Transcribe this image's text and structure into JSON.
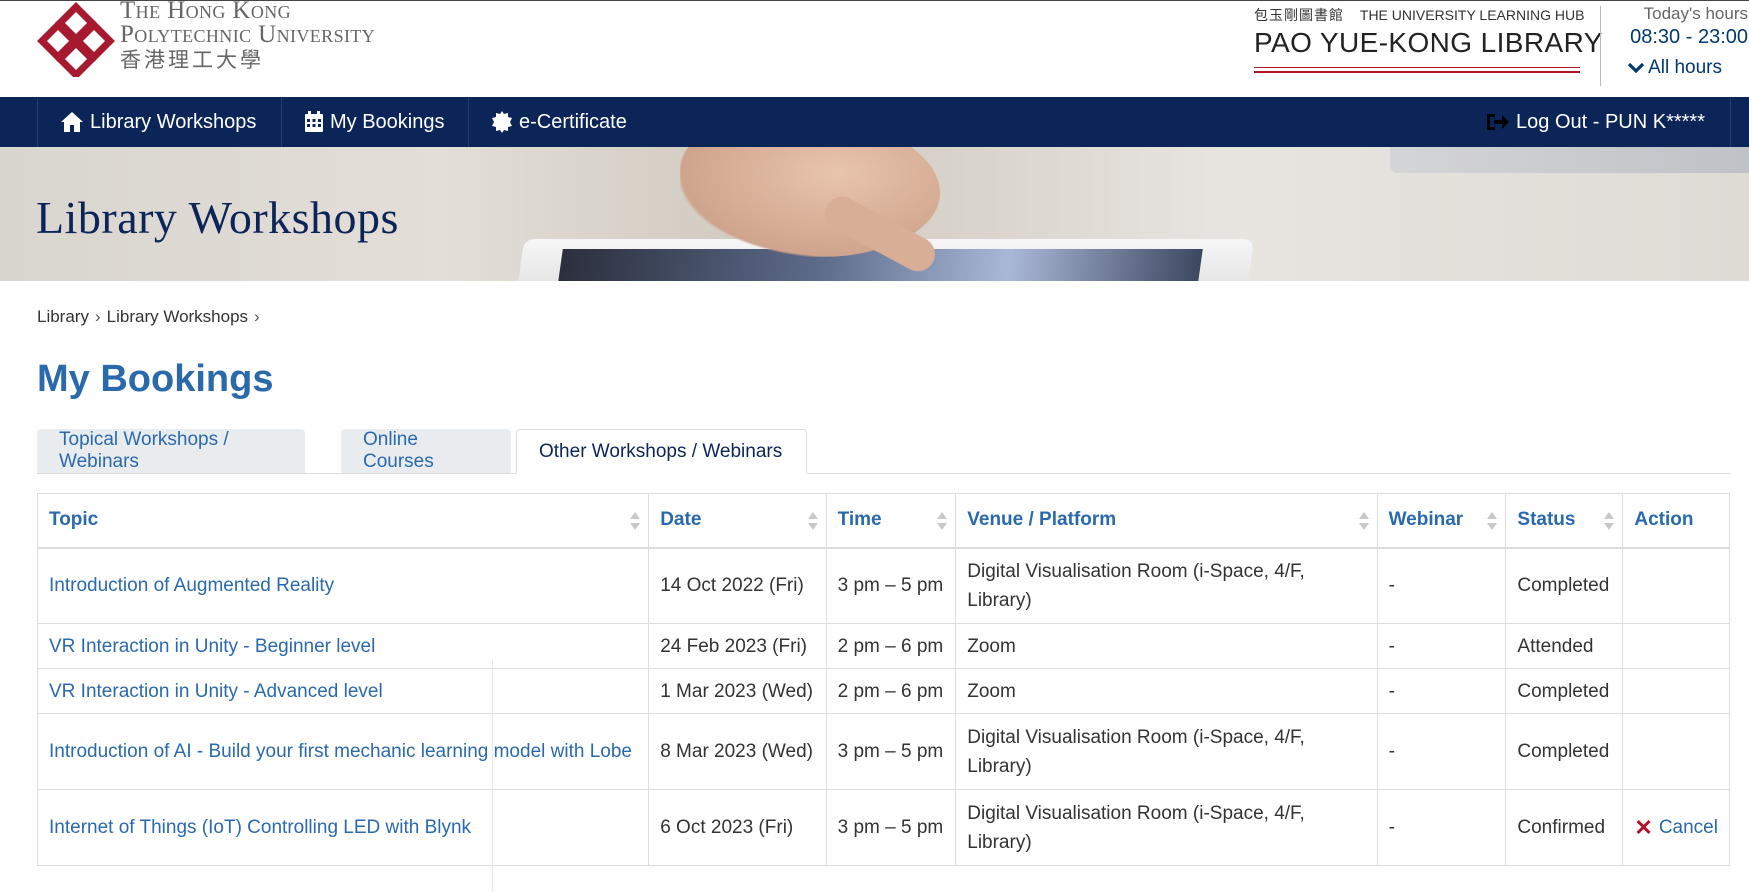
{
  "header": {
    "polyu": {
      "line1": "The Hong Kong",
      "line2": "Polytechnic University",
      "line3": "香港理工大學"
    },
    "library": {
      "chinese": "包玉剛圖書館",
      "tagline": "THE UNIVERSITY LEARNING HUB",
      "name": "PAO YUE-KONG LIBRARY"
    },
    "hours": {
      "label": "Today's hours",
      "time": "08:30 - 23:00",
      "all_label": "All hours"
    }
  },
  "nav": {
    "items": [
      {
        "label": "Library Workshops",
        "icon": "home-icon"
      },
      {
        "label": "My Bookings",
        "icon": "calendar-icon"
      },
      {
        "label": "e-Certificate",
        "icon": "certificate-icon"
      }
    ],
    "logout": {
      "label": "Log Out - PUN K*****",
      "icon": "logout-icon"
    }
  },
  "banner": {
    "title": "Library Workshops"
  },
  "breadcrumb": {
    "items": [
      "Library",
      "Library Workshops"
    ],
    "separator": "›"
  },
  "page_title": "My Bookings",
  "tabs": [
    {
      "label": "Topical Workshops / Webinars",
      "active": false
    },
    {
      "label": "Online Courses",
      "active": false
    },
    {
      "label": "Other Workshops / Webinars",
      "active": true
    }
  ],
  "table": {
    "headers": [
      "Topic",
      "Date",
      "Time",
      "Venue / Platform",
      "Webinar",
      "Status",
      "Action"
    ],
    "rows": [
      {
        "topic": "Introduction of Augmented Reality",
        "date": "14 Oct 2022 (Fri)",
        "time": "3 pm – 5 pm",
        "venue": "Digital Visualisation Room (i-Space, 4/F, Library)",
        "webinar": "-",
        "status": "Completed",
        "action": ""
      },
      {
        "topic": "VR Interaction in Unity - Beginner level",
        "date": "24 Feb 2023 (Fri)",
        "time": "2 pm – 6 pm",
        "venue": "Zoom",
        "webinar": "-",
        "status": "Attended",
        "action": ""
      },
      {
        "topic": "VR Interaction in Unity - Advanced level",
        "date": "1 Mar 2023 (Wed)",
        "time": "2 pm – 6 pm",
        "venue": "Zoom",
        "webinar": "-",
        "status": "Completed",
        "action": ""
      },
      {
        "topic": "Introduction of AI - Build your first mechanic learning model with Lobe",
        "date": "8 Mar 2023 (Wed)",
        "time": "3 pm – 5 pm",
        "venue": "Digital Visualisation Room (i-Space, 4/F, Library)",
        "webinar": "-",
        "status": "Completed",
        "action": ""
      },
      {
        "topic": "Internet of Things (IoT) Controlling LED with Blynk",
        "date": "6 Oct 2023 (Fri)",
        "time": "3 pm – 5 pm",
        "venue": "Digital Visualisation Room (i-Space, 4/F, Library)",
        "webinar": "-",
        "status": "Confirmed",
        "action": "Cancel"
      }
    ]
  },
  "colors": {
    "navy": "#0c2559",
    "link": "#2a6aac",
    "accent_red": "#b0142b"
  }
}
